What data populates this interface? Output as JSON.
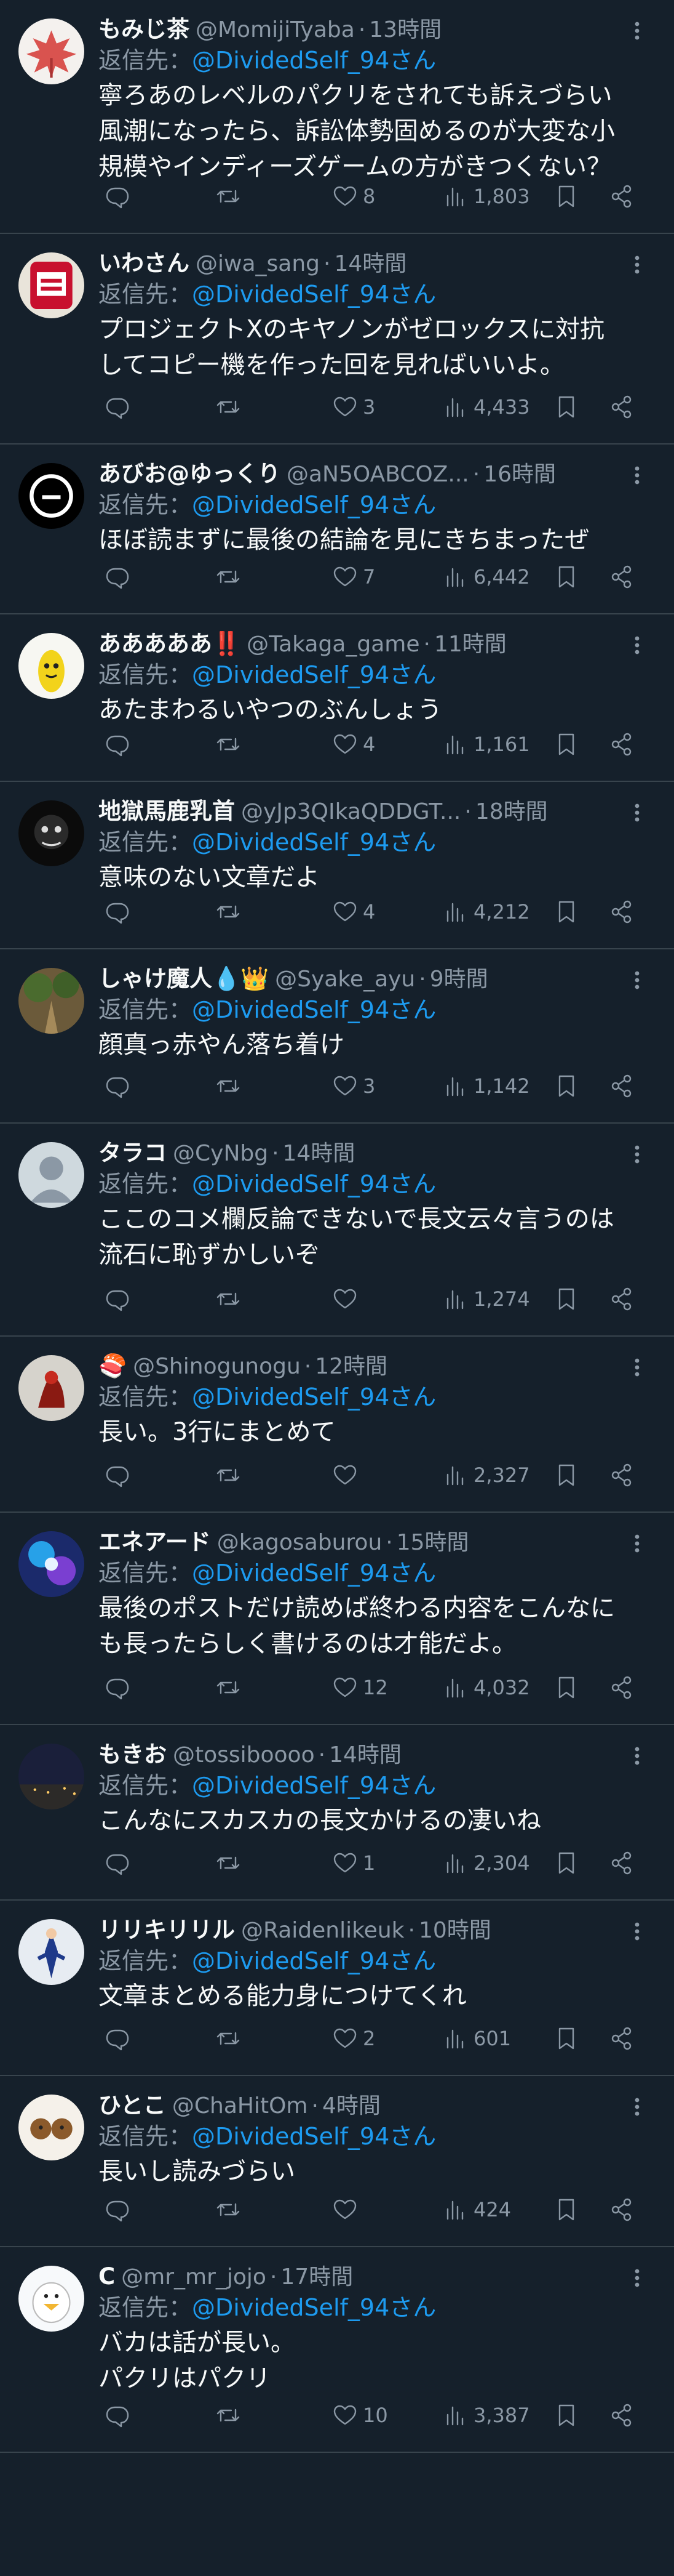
{
  "reply_prefix": "返信先：",
  "reply_to": "@DividedSelf_94さん",
  "icons": {
    "reply": "reply-icon",
    "retweet": "retweet-icon",
    "like": "like-icon",
    "views": "views-icon",
    "bookmark": "bookmark-icon",
    "share": "share-icon",
    "more": "more-icon"
  },
  "colors": {
    "background": "#15202b",
    "text": "#f7f9f9",
    "muted": "#8b98a5",
    "link": "#1d9bf0",
    "divider": "#38444d"
  },
  "tweets": [
    {
      "name": "もみじ茶",
      "handle": "@MomijiTyaba",
      "time": "13時間",
      "text": "寧ろあのレベルのパクリをされても訴えづらい\n風潮になったら、訴訟体勢固めるのが大変な小\n規模やインディーズゲームの方がきつくない？",
      "likes": "8",
      "views": "1,803"
    },
    {
      "name": "いわさん",
      "handle": "@iwa_sang",
      "time": "14時間",
      "text": "プロジェクトXのキヤノンがゼロックスに対抗\nしてコピー機を作った回を見ればいいよ。",
      "likes": "3",
      "views": "4,433"
    },
    {
      "name": "あびお@ゆっくり",
      "handle": "@aN5OABCOZ...",
      "time": "16時間",
      "text": "ほぼ読まずに最後の結論を見にきちまったぜ",
      "likes": "7",
      "views": "6,442"
    },
    {
      "name": "あああああ‼️",
      "handle": "@Takaga_game",
      "time": "11時間",
      "text": "あたまわるいやつのぶんしょう",
      "likes": "4",
      "views": "1,161"
    },
    {
      "name": "地獄馬鹿乳首",
      "handle": "@yJp3QIkaQDDGT...",
      "time": "18時間",
      "text": "意味のない文章だよ",
      "likes": "4",
      "views": "4,212"
    },
    {
      "name": "しゃけ魔人💧👑",
      "handle": "@Syake_ayu",
      "time": "9時間",
      "text": "顔真っ赤やん落ち着け",
      "likes": "3",
      "views": "1,142"
    },
    {
      "name": "タラコ",
      "handle": "@CyNbg",
      "time": "14時間",
      "text": "ここのコメ欄反論できないで長文云々言うのは\n流石に恥ずかしいぞ",
      "likes": "",
      "views": "1,274"
    },
    {
      "name": "🍣",
      "handle": "@Shinogunogu",
      "time": "12時間",
      "text": "長い。3行にまとめて",
      "likes": "",
      "views": "2,327"
    },
    {
      "name": "エネアード",
      "handle": "@kagosaburou",
      "time": "15時間",
      "text": "最後のポストだけ読めば終わる内容をこんなに\nも長ったらしく書けるのは才能だよ。",
      "likes": "12",
      "views": "4,032"
    },
    {
      "name": "もきお",
      "handle": "@tossiboooo",
      "time": "14時間",
      "text": "こんなにスカスカの長文かけるの凄いね",
      "likes": "1",
      "views": "2,304"
    },
    {
      "name": "リリキリリル",
      "handle": "@Raidenlikeuk",
      "time": "10時間",
      "text": "文章まとめる能力身につけてくれ",
      "likes": "2",
      "views": "601"
    },
    {
      "name": "ひとこ",
      "handle": "@ChaHitOm",
      "time": "4時間",
      "text": "長いし読みづらい",
      "likes": "",
      "views": "424"
    },
    {
      "name": "C",
      "handle": "@mr_mr_jojo",
      "time": "17時間",
      "text": "バカは話が長い。\nパクリはパクリ",
      "likes": "10",
      "views": "3,387"
    }
  ]
}
